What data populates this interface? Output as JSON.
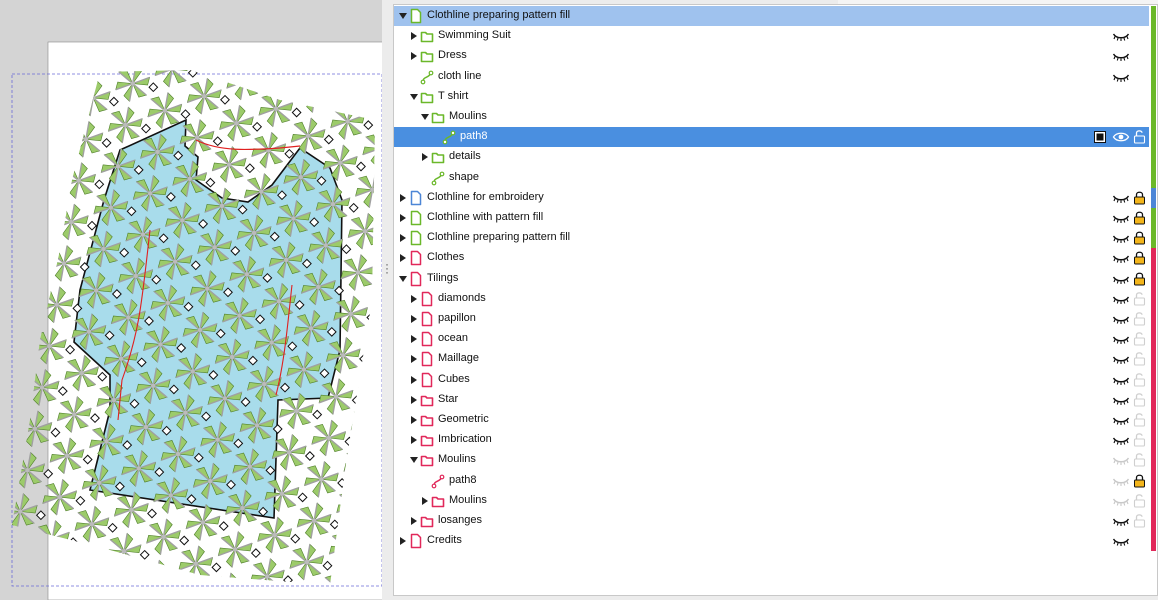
{
  "colors": {
    "green": "#6bb82a",
    "blue": "#4d86d6",
    "red": "#e1285a",
    "selection": "#4a8fe0",
    "parent_selection": "#9fc2ee",
    "canvas_bg": "#d4d4d4",
    "shirt_fill": "#a8dceb"
  },
  "layers": [
    {
      "label": "Clothline  preparing pattern fill",
      "depth": 0,
      "arrow": "down",
      "type": "layer",
      "color": "green",
      "state": "parent-selected",
      "eye": "none",
      "lock": "none"
    },
    {
      "label": "Swimming Suit",
      "depth": 1,
      "arrow": "right",
      "type": "group",
      "color": "green",
      "eye": "closed",
      "lock": "none"
    },
    {
      "label": "Dress",
      "depth": 1,
      "arrow": "right",
      "type": "group",
      "color": "green",
      "eye": "closed",
      "lock": "none"
    },
    {
      "label": "cloth line",
      "depth": 1,
      "arrow": "none",
      "type": "path",
      "color": "green",
      "eye": "closed",
      "lock": "none"
    },
    {
      "label": "T shirt",
      "depth": 1,
      "arrow": "down",
      "type": "group",
      "color": "green",
      "eye": "none",
      "lock": "none"
    },
    {
      "label": "Moulins",
      "depth": 2,
      "arrow": "down",
      "type": "group",
      "color": "green",
      "eye": "none",
      "lock": "none"
    },
    {
      "label": "path8",
      "depth": 3,
      "arrow": "none",
      "type": "path",
      "color": "green",
      "state": "selected",
      "eye": "open",
      "lock": "open",
      "box": true
    },
    {
      "label": "details",
      "depth": 2,
      "arrow": "right",
      "type": "group",
      "color": "green",
      "eye": "none",
      "lock": "none"
    },
    {
      "label": "shape",
      "depth": 2,
      "arrow": "none",
      "type": "path",
      "color": "green",
      "eye": "none",
      "lock": "none"
    },
    {
      "label": "Clothline for embroidery",
      "depth": 0,
      "arrow": "right",
      "type": "layer",
      "color": "blue",
      "eye": "closed",
      "lock": "locked"
    },
    {
      "label": "Clothline  with pattern fill",
      "depth": 0,
      "arrow": "right",
      "type": "layer",
      "color": "green",
      "eye": "closed",
      "lock": "locked"
    },
    {
      "label": "Clothline  preparing pattern fill",
      "depth": 0,
      "arrow": "right",
      "type": "layer",
      "color": "green",
      "eye": "closed",
      "lock": "locked"
    },
    {
      "label": "Clothes",
      "depth": 0,
      "arrow": "right",
      "type": "layer",
      "color": "red",
      "eye": "closed",
      "lock": "locked"
    },
    {
      "label": "Tilings",
      "depth": 0,
      "arrow": "down",
      "type": "layer",
      "color": "red",
      "eye": "closed",
      "lock": "locked"
    },
    {
      "label": "diamonds",
      "depth": 1,
      "arrow": "right",
      "type": "layer",
      "color": "red",
      "eye": "closed",
      "lock": "faded"
    },
    {
      "label": "papillon",
      "depth": 1,
      "arrow": "right",
      "type": "layer",
      "color": "red",
      "eye": "closed",
      "lock": "faded"
    },
    {
      "label": "ocean",
      "depth": 1,
      "arrow": "right",
      "type": "layer",
      "color": "red",
      "eye": "closed",
      "lock": "faded"
    },
    {
      "label": "Maillage",
      "depth": 1,
      "arrow": "right",
      "type": "layer",
      "color": "red",
      "eye": "closed",
      "lock": "faded"
    },
    {
      "label": "Cubes",
      "depth": 1,
      "arrow": "right",
      "type": "layer",
      "color": "red",
      "eye": "closed",
      "lock": "faded"
    },
    {
      "label": "Star",
      "depth": 1,
      "arrow": "right",
      "type": "group",
      "color": "red",
      "eye": "closed",
      "lock": "faded"
    },
    {
      "label": "Geometric",
      "depth": 1,
      "arrow": "right",
      "type": "group",
      "color": "red",
      "eye": "closed",
      "lock": "faded"
    },
    {
      "label": "Imbrication",
      "depth": 1,
      "arrow": "right",
      "type": "group",
      "color": "red",
      "eye": "closed",
      "lock": "faded"
    },
    {
      "label": "Moulins",
      "depth": 1,
      "arrow": "down",
      "type": "group",
      "color": "red",
      "eye": "faded",
      "lock": "faded"
    },
    {
      "label": "path8",
      "depth": 2,
      "arrow": "none",
      "type": "path",
      "color": "red",
      "eye": "faded",
      "lock": "locked"
    },
    {
      "label": "Moulins",
      "depth": 2,
      "arrow": "right",
      "type": "group",
      "color": "red",
      "eye": "faded",
      "lock": "faded"
    },
    {
      "label": "losanges",
      "depth": 1,
      "arrow": "right",
      "type": "group",
      "color": "red",
      "eye": "closed",
      "lock": "faded"
    },
    {
      "label": "Credits",
      "depth": 0,
      "arrow": "right",
      "type": "layer",
      "color": "red",
      "eye": "closed",
      "lock": "none"
    }
  ]
}
